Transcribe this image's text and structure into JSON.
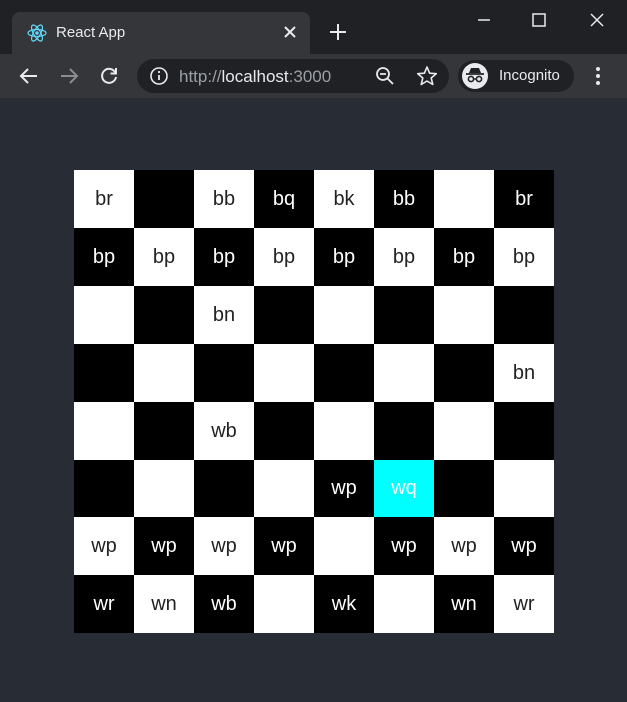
{
  "browser": {
    "tab_title": "React App",
    "url_scheme": "http://",
    "url_host": "localhost",
    "url_port": ":3000",
    "profile_label": "Incognito"
  },
  "board": {
    "rows": [
      [
        "br",
        "",
        "bb",
        "bq",
        "bk",
        "bb",
        "",
        "br"
      ],
      [
        "bp",
        "bp",
        "bp",
        "bp",
        "bp",
        "bp",
        "bp",
        "bp"
      ],
      [
        "",
        "",
        "bn",
        "",
        "",
        "",
        "",
        ""
      ],
      [
        "",
        "",
        "",
        "",
        "",
        "",
        "",
        "bn"
      ],
      [
        "",
        "",
        "wb",
        "",
        "",
        "",
        "",
        ""
      ],
      [
        "",
        "",
        "",
        "",
        "wp",
        "wq",
        "",
        ""
      ],
      [
        "wp",
        "wp",
        "wp",
        "wp",
        "",
        "wp",
        "wp",
        "wp"
      ],
      [
        "wr",
        "wn",
        "wb",
        "",
        "wk",
        "",
        "wn",
        "wr"
      ]
    ],
    "highlighted_square": "5-5",
    "colors": {
      "light": "#ffffff",
      "dark": "#000000",
      "highlight": "#00ffff",
      "page_background": "#282c34"
    }
  },
  "icons": {
    "favicon": "react-logo-icon",
    "tab_close": "close-icon",
    "new_tab": "plus-icon",
    "minimize": "minimize-icon",
    "maximize": "maximize-icon",
    "close_window": "close-icon",
    "back": "back-arrow-icon",
    "forward": "forward-arrow-icon",
    "reload": "reload-icon",
    "site_info": "info-icon",
    "zoom": "zoom-out-icon",
    "bookmark": "star-icon",
    "incognito": "incognito-icon",
    "menu": "more-vertical-icon"
  }
}
